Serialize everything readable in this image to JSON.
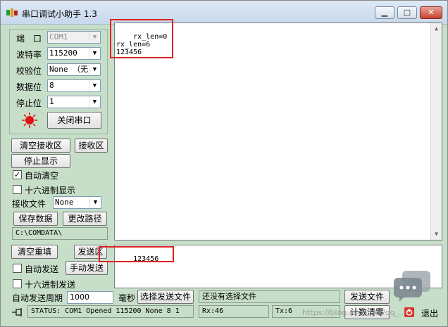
{
  "window": {
    "title": "串口调试小助手 1.3",
    "minimize_icon": "minimize-icon",
    "maximize_icon": "maximize-icon",
    "close_icon": "close-icon"
  },
  "settings": {
    "port_label": "端　口",
    "port_value": "COM1",
    "baud_label": "波特率",
    "baud_value": "115200",
    "parity_label": "校验位",
    "parity_value": "None （无）",
    "databits_label": "数据位",
    "databits_value": "8",
    "stopbits_label": "停止位",
    "stopbits_value": "1",
    "port_status_icon": "red-lamp-icon",
    "toggle_port_label": "关闭串口"
  },
  "receive_controls": {
    "clear_receive_label": "清空接收区",
    "receive_area_label": "接收区",
    "stop_display_label": "停止显示",
    "auto_clear_label": "自动清空",
    "auto_clear_checked": true,
    "hex_display_label": "十六进制显示",
    "hex_display_checked": false,
    "receive_file_label": "接收文件",
    "receive_file_value": "None",
    "save_data_label": "保存数据",
    "change_path_label": "更改路径",
    "path_value": "C:\\COMDATA\\"
  },
  "receive_area": {
    "text": "rx_len=0\nrx_len=6\n123456"
  },
  "send_controls": {
    "clear_resend_label": "清空重填",
    "send_area_label": "发送区",
    "auto_send_label": "自动发送",
    "auto_send_checked": false,
    "manual_send_label": "手动发送",
    "hex_send_label": "十六进制发送",
    "hex_send_checked": false,
    "period_label": "自动发送周期",
    "period_value": "1000",
    "ms_label": "毫秒",
    "choose_file_label": "选择发送文件",
    "file_status": "还没有选择文件",
    "send_file_label": "发送文件",
    "count_clear_label": "计数清零",
    "exit_label": "退出",
    "exit_icon": "exit-icon"
  },
  "send_area": {
    "text": "123456"
  },
  "status_bar": {
    "pin_icon": "pin-icon",
    "status_text": "STATUS: COM1 Opened 115200 None  8 1",
    "rx_text": "Rx:46",
    "tx_text": "Tx:6"
  },
  "watermark": {
    "text": "https://blog.csdn.net/qq_..."
  },
  "colors": {
    "window_bg": "#c7dec9",
    "highlight": "#e02020",
    "lamp": "#e01010"
  }
}
